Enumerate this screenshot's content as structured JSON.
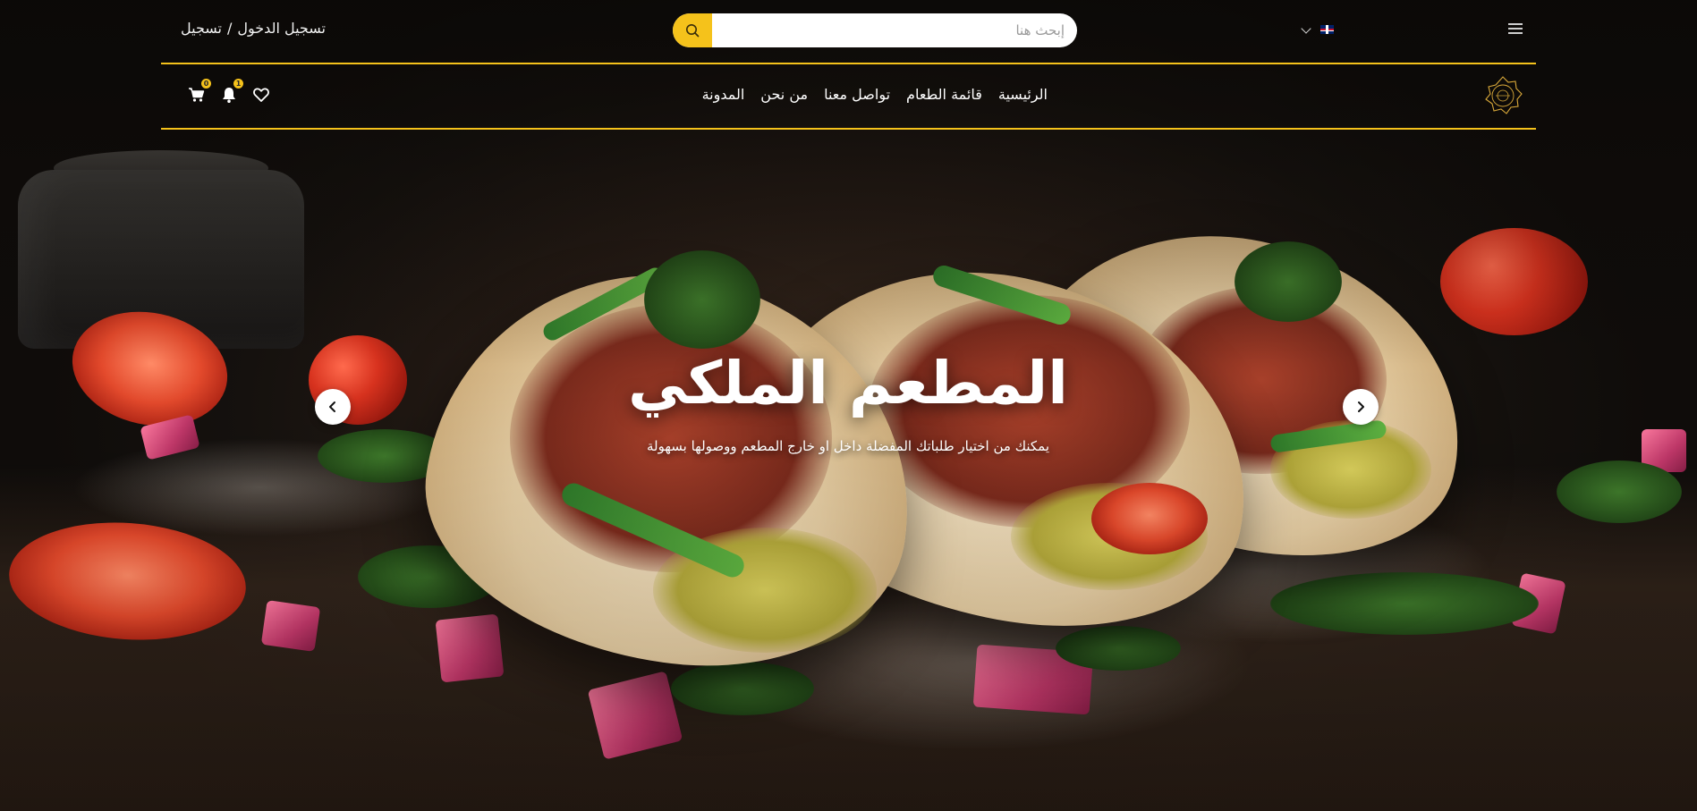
{
  "header": {
    "auth": {
      "login_label": "تسجيل الدخول",
      "separator": "/",
      "register_label": "تسجيل"
    },
    "search": {
      "placeholder": "إبحث هنا"
    },
    "language": {
      "flag": "uk-flag-icon"
    }
  },
  "nav": {
    "links": [
      {
        "label": "الرئيسية"
      },
      {
        "label": "قائمة الطعام"
      },
      {
        "label": "تواصل معنا"
      },
      {
        "label": "من نحن"
      },
      {
        "label": "المدونة"
      }
    ],
    "icons": {
      "wishlist": "heart-icon",
      "notifications": {
        "icon": "bell-icon",
        "count": "1"
      },
      "cart": {
        "icon": "cart-icon",
        "count": "0"
      }
    }
  },
  "hero": {
    "title": "المطعم الملكي",
    "subtitle": "يمكنك من اختيار طلباتك المفضلة داخل او خارج المطعم ووصولها بسهولة"
  },
  "colors": {
    "accent": "#f5c21b",
    "text": "#ffffff",
    "background": "#1a1512"
  }
}
